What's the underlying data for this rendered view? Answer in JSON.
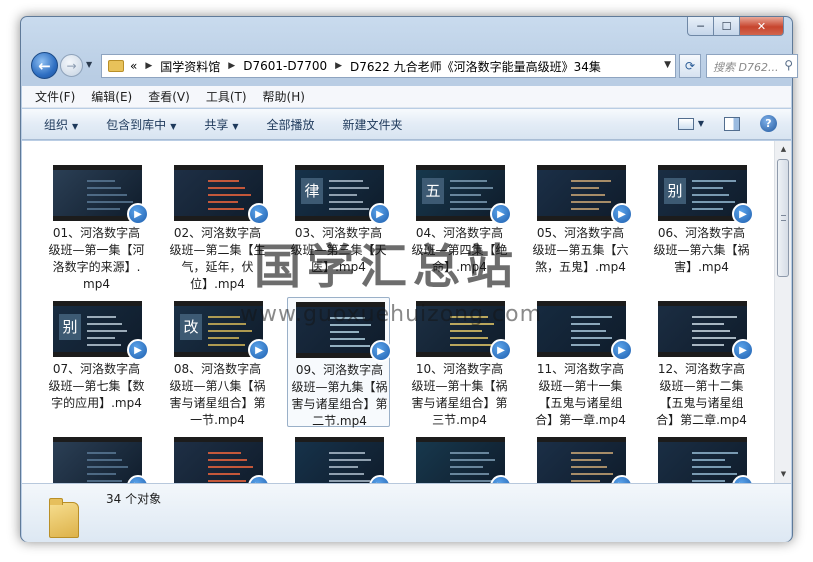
{
  "window": {
    "controls": {
      "minimize": "─",
      "maximize": "☐",
      "close": "✕"
    }
  },
  "nav": {
    "back_icon": "back-arrow-icon",
    "forward_icon": "forward-arrow-icon",
    "breadcrumb_prefix": "«",
    "breadcrumbs": [
      "国学资料馆",
      "D7601-D7700",
      "D7622 九合老师《河洛数字能量高级班》34集"
    ],
    "search_placeholder": "搜索 D762..."
  },
  "menu": [
    "文件(F)",
    "编辑(E)",
    "查看(V)",
    "工具(T)",
    "帮助(H)"
  ],
  "toolbar": {
    "organize": "组织",
    "include_library": "包含到库中",
    "share": "共享",
    "play_all": "全部播放",
    "new_folder": "新建文件夹"
  },
  "files": [
    {
      "name": "01、河洛数字高级班—第一集【河洛数字的来源】.mp4",
      "glyph": ""
    },
    {
      "name": "02、河洛数字高级班—第二集【生气，延年，伏位】.mp4",
      "glyph": ""
    },
    {
      "name": "03、河洛数字高级班—第三集【天医】.mp4",
      "glyph": "律"
    },
    {
      "name": "04、河洛数字高级班—第四集【绝命】.mp4",
      "glyph": "五"
    },
    {
      "name": "05、河洛数字高级班—第五集【六煞，五鬼】.mp4",
      "glyph": ""
    },
    {
      "name": "06、河洛数字高级班—第六集【祸害】.mp4",
      "glyph": "别"
    },
    {
      "name": "07、河洛数字高级班—第七集【数字的应用】.mp4",
      "glyph": "别"
    },
    {
      "name": "08、河洛数字高级班—第八集【祸害与诸星组合】第一节.mp4",
      "glyph": "改"
    },
    {
      "name": "09、河洛数字高级班—第九集【祸害与诸星组合】第二节.mp4",
      "glyph": ""
    },
    {
      "name": "10、河洛数字高级班—第十集【祸害与诸星组合】第三节.mp4",
      "glyph": ""
    },
    {
      "name": "11、河洛数字高级班—第十一集【五鬼与诸星组合】第一章.mp4",
      "glyph": ""
    },
    {
      "name": "12、河洛数字高级班—第十二集【五鬼与诸星组合】第二章.mp4",
      "glyph": ""
    },
    {
      "name": "",
      "glyph": ""
    },
    {
      "name": "",
      "glyph": ""
    },
    {
      "name": "",
      "glyph": ""
    },
    {
      "name": "",
      "glyph": ""
    },
    {
      "name": "",
      "glyph": ""
    },
    {
      "name": "",
      "glyph": ""
    }
  ],
  "watermark": {
    "title": "国学汇总站",
    "url": "www.guoxuehuizong.com"
  },
  "status": {
    "count": "34 个对象"
  }
}
